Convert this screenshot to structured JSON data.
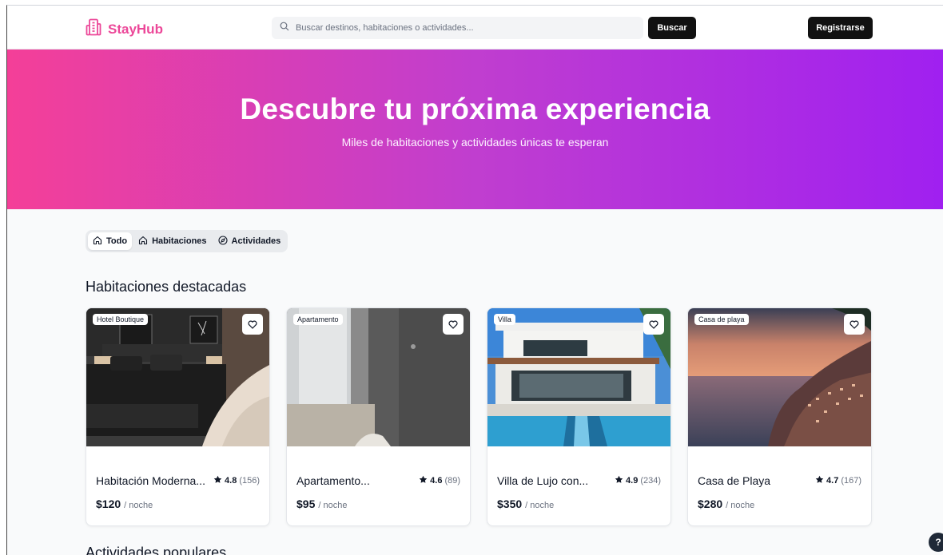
{
  "header": {
    "logo_text": "StayHub",
    "search_placeholder": "Buscar destinos, habitaciones o actividades...",
    "search_button": "Buscar",
    "register_button": "Registrarse"
  },
  "hero": {
    "title": "Descubre tu próxima experiencia",
    "subtitle": "Miles de habitaciones y actividades únicas te esperan"
  },
  "tabs": [
    {
      "label": "Todo",
      "icon": "home-icon",
      "active": true
    },
    {
      "label": "Habitaciones",
      "icon": "home-icon",
      "active": false
    },
    {
      "label": "Actividades",
      "icon": "compass-icon",
      "active": false
    }
  ],
  "featured": {
    "title": "Habitaciones destacadas",
    "cards": [
      {
        "badge": "Hotel Boutique",
        "name": "Habitación Moderna...",
        "rating": "4.8",
        "reviews": "(156)",
        "price": "$120",
        "unit": "/ noche"
      },
      {
        "badge": "Apartamento",
        "name": "Apartamento...",
        "rating": "4.6",
        "reviews": "(89)",
        "price": "$95",
        "unit": "/ noche"
      },
      {
        "badge": "Villa",
        "name": "Villa de Lujo con...",
        "rating": "4.9",
        "reviews": "(234)",
        "price": "$350",
        "unit": "/ noche"
      },
      {
        "badge": "Casa de playa",
        "name": "Casa de Playa",
        "rating": "4.7",
        "reviews": "(167)",
        "price": "$280",
        "unit": "/ noche"
      }
    ]
  },
  "activities": {
    "title": "Actividades populares"
  },
  "help_label": "?",
  "colors": {
    "brand": "#ec4899",
    "hero_start": "#f43f98",
    "hero_end": "#a020f0",
    "button_dark": "#111111"
  }
}
